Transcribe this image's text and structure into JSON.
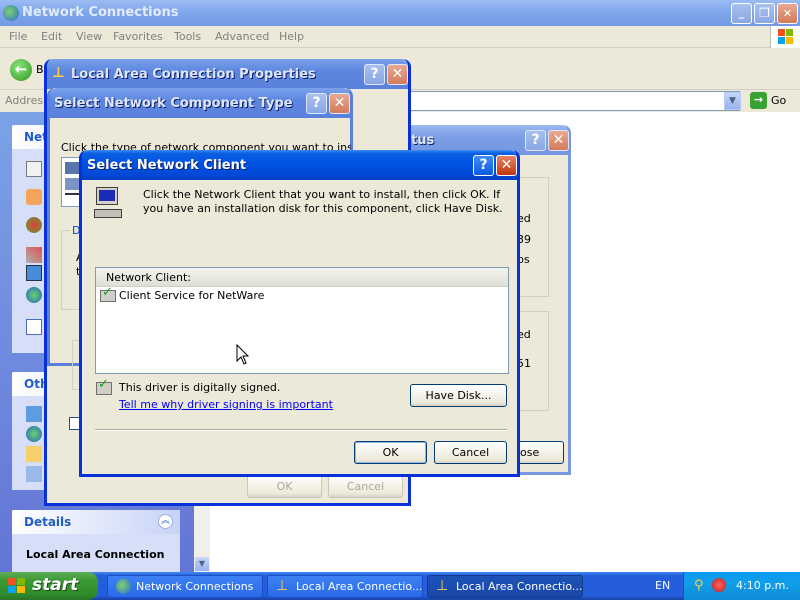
{
  "explorer": {
    "title": "Network Connections",
    "menu": [
      "File",
      "Edit",
      "View",
      "Favorites",
      "Tools",
      "Advanced",
      "Help"
    ],
    "back_label": "B",
    "address_label": "Address",
    "go_label": "Go",
    "left_pane": {
      "network_tasks_head": "Netw",
      "other_places_head": "Oth",
      "details_head": "Details",
      "details_title": "Local Area Connection"
    }
  },
  "lac_properties": {
    "title": "Local Area Connection Properties",
    "ok_label": "OK",
    "cancel_label": "Cancel"
  },
  "component_type": {
    "title": "Select Network Component Type",
    "instruction": "Click the type of network component you want to install:",
    "desc_fragment": "De",
    "desc_a": "A",
    "desc_th": "th"
  },
  "status_window": {
    "title_fragment": "tus",
    "line1": "ed",
    "line2": "39",
    "line3": "ps",
    "line4": "ed",
    "line5": "51",
    "close_label": "ose"
  },
  "select_client": {
    "title": "Select Network Client",
    "instruction": "Click the Network Client that you want to install, then click OK. If you have an installation disk for this component, click Have Disk.",
    "list_header": "Network Client:",
    "items": [
      "Client Service for NetWare"
    ],
    "signed_text": "This driver is digitally signed.",
    "signing_link": "Tell me why driver signing is important",
    "have_disk_label": "Have Disk...",
    "ok_label": "OK",
    "cancel_label": "Cancel"
  },
  "taskbar": {
    "start_label": "start",
    "tasks": [
      {
        "label": "Network Connections"
      },
      {
        "label": "Local Area Connectio..."
      },
      {
        "label": "Local Area Connectio..."
      }
    ],
    "language": "EN",
    "clock": "4:10 p.m."
  },
  "colors": {
    "xp_blue": "#0054e3",
    "link_blue": "#0000ff",
    "start_green": "#3c9a36"
  }
}
